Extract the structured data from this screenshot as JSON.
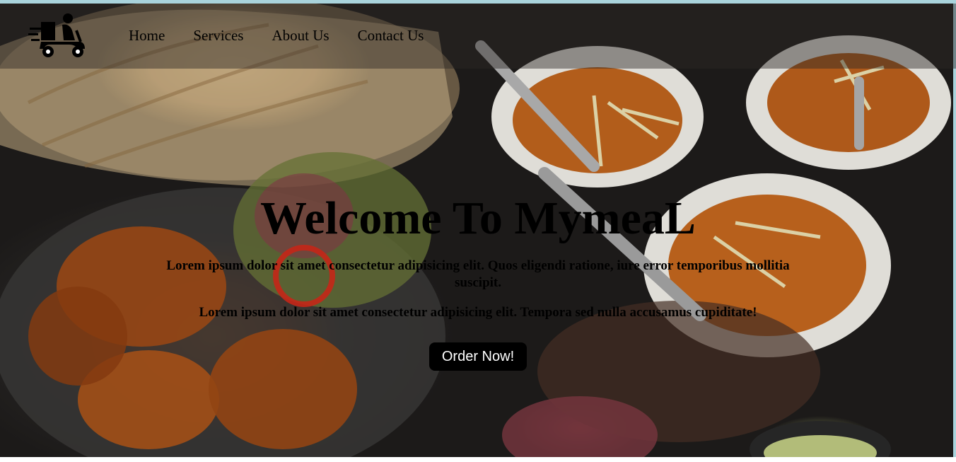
{
  "nav": {
    "logo_icon": "delivery-scooter-icon",
    "items": [
      {
        "label": "Home"
      },
      {
        "label": "Services"
      },
      {
        "label": "About Us"
      },
      {
        "label": "Contact Us"
      }
    ]
  },
  "hero": {
    "title": "Welcome To MymeaL",
    "paragraph1": "Lorem ipsum dolor sit amet consectetur adipisicing elit. Quos eligendi ratione, iure error temporibus mollitia suscipit.",
    "paragraph2": "Lorem ipsum dolor sit amet consectetur adipisicing elit. Tempora sed nulla accusamus cupiditate!",
    "cta_label": "Order Now!",
    "background_image": "indian-food-spread"
  },
  "colors": {
    "accent_border": "#a9d3dc",
    "button_bg": "#000000",
    "button_text": "#ffffff"
  }
}
